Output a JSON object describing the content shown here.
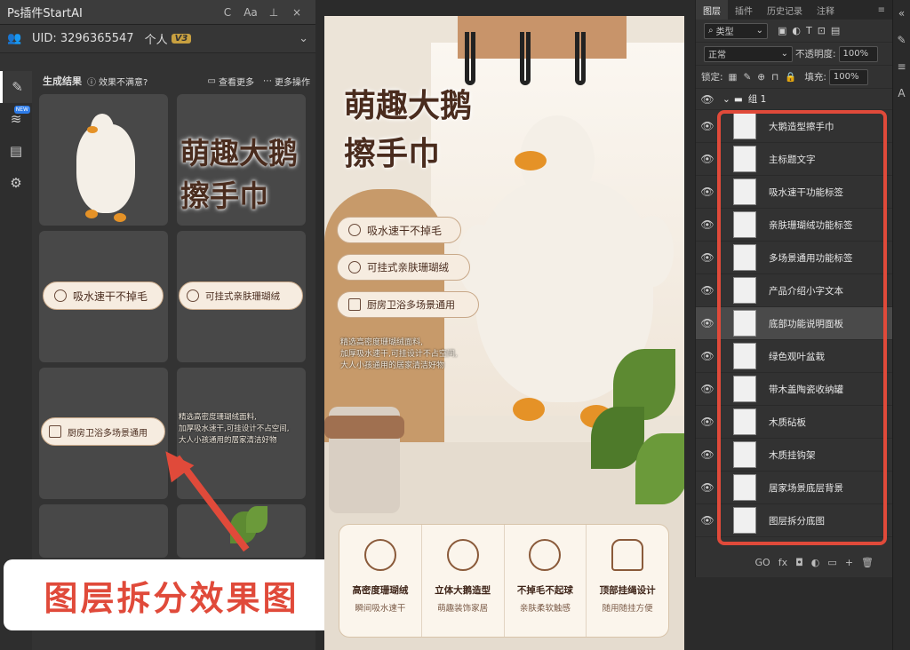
{
  "plugin": {
    "title": "Ps插件StartAI",
    "title_icons": [
      "C",
      "Aa",
      "⊥",
      "×"
    ],
    "uid_label": "UID: 3296365547",
    "plan": "个人",
    "plan_badge": "V3",
    "results_label": "生成结果",
    "unsatisfied": "效果不满意?",
    "view_more": "查看更多",
    "more_ops": "更多操作",
    "new_tag": "NEW"
  },
  "preview": {
    "title_line1": "萌趣大鹅",
    "title_line2": "擦手巾",
    "pill_1": "吸水速干不掉毛",
    "pill_2": "可挂式亲肤珊瑚绒",
    "pill_3": "厨房卫浴多场景通用",
    "desc_1": "精选高密度珊瑚绒面料,",
    "desc_2": "加厚吸水速干,可挂设计不占空间,",
    "desc_3": "大人小孩通用的居家清洁好物"
  },
  "annotation": {
    "label": "图层拆分效果图"
  },
  "canvas": {
    "title_line1": "萌趣大鹅",
    "title_line2": "擦手巾",
    "pills": [
      "吸水速干不掉毛",
      "可挂式亲肤珊瑚绒",
      "厨房卫浴多场景通用"
    ],
    "desc": [
      "精选高密度珊瑚绒面料,",
      "加厚吸水速干,可挂设计不占空间,",
      "大人小孩通用的居家清洁好物"
    ],
    "features": [
      {
        "title": "高密度珊瑚绒",
        "sub": "瞬间吸水速干"
      },
      {
        "title": "立体大鹅造型",
        "sub": "萌趣装饰家居"
      },
      {
        "title": "不掉毛不起球",
        "sub": "亲肤柔软触感"
      },
      {
        "title": "顶部挂绳设计",
        "sub": "随用随挂方便"
      }
    ]
  },
  "layers": {
    "tabs": [
      "图层",
      "插件",
      "历史记录",
      "注释"
    ],
    "kind_label": "类型",
    "blend_mode": "正常",
    "opacity_label": "不透明度:",
    "opacity_value": "100%",
    "lock_label": "锁定:",
    "fill_label": "填充:",
    "fill_value": "100%",
    "group_name": "组 1",
    "items": [
      "大鹅造型擦手巾",
      "主标题文字",
      "吸水速干功能标签",
      "亲肤珊瑚绒功能标签",
      "多场景通用功能标签",
      "产品介绍小字文本",
      "底部功能说明面板",
      "绿色观叶盆栽",
      "带木盖陶瓷收纳罐",
      "木质砧板",
      "木质挂钩架",
      "居家场景底层背景",
      "图层拆分底图"
    ],
    "bottom_icons": [
      "GO",
      "fx",
      "◘",
      "◐",
      "▭",
      "+",
      "🗑"
    ]
  },
  "colors": {
    "accent_red": "#e04a3a",
    "brown_text": "#4a2c1e",
    "plan_gold": "#c8a040"
  }
}
